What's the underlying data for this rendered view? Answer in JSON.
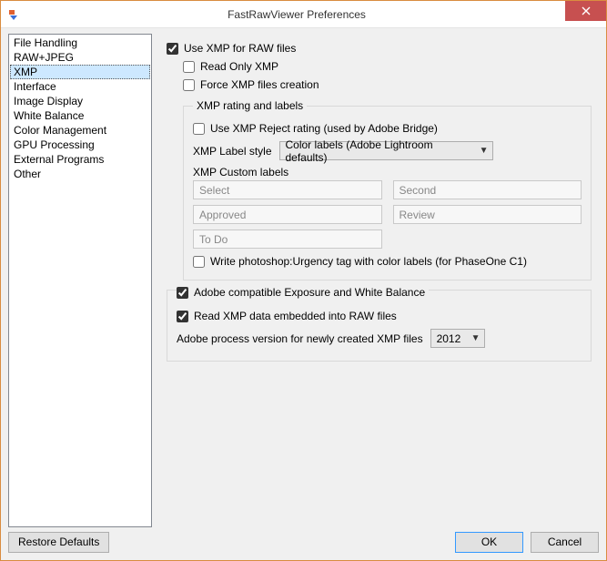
{
  "window": {
    "title": "FastRawViewer Preferences"
  },
  "sidebar": {
    "items": [
      {
        "label": "File Handling",
        "selected": false
      },
      {
        "label": "RAW+JPEG",
        "selected": false
      },
      {
        "label": "XMP",
        "selected": true
      },
      {
        "label": "Interface",
        "selected": false
      },
      {
        "label": "Image Display",
        "selected": false
      },
      {
        "label": "White Balance",
        "selected": false
      },
      {
        "label": "Color Management",
        "selected": false
      },
      {
        "label": "GPU Processing",
        "selected": false
      },
      {
        "label": "External Programs",
        "selected": false
      },
      {
        "label": "Other",
        "selected": false
      }
    ]
  },
  "xmp": {
    "use_xmp_label": "Use XMP for RAW files",
    "use_xmp_checked": true,
    "read_only_label": "Read Only XMP",
    "read_only_checked": false,
    "force_label": "Force XMP files creation",
    "force_checked": false,
    "group_rating_title": "XMP rating and labels",
    "use_reject_label": "Use XMP Reject rating (used by Adobe Bridge)",
    "use_reject_checked": false,
    "label_style_caption": "XMP Label style",
    "label_style_value": "Color labels (Adobe Lightroom defaults)",
    "custom_labels_caption": "XMP Custom labels",
    "custom_labels": {
      "l1": "Select",
      "l2": "Second",
      "l3": "Approved",
      "l4": "Review",
      "l5": "To Do"
    },
    "write_urgency_label": "Write photoshop:Urgency tag with color labels (for PhaseOne C1)",
    "write_urgency_checked": false,
    "adobe_compat_label": "Adobe compatible Exposure and White Balance",
    "adobe_compat_checked": true,
    "read_embedded_label": "Read XMP data embedded into RAW files",
    "read_embedded_checked": true,
    "process_version_caption": "Adobe process version for newly created XMP files",
    "process_version_value": "2012"
  },
  "footer": {
    "restore": "Restore Defaults",
    "ok": "OK",
    "cancel": "Cancel"
  }
}
